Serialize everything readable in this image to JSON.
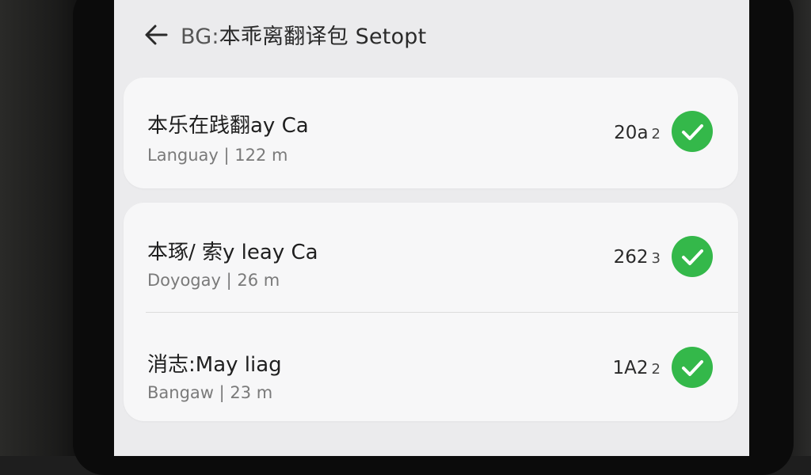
{
  "header": {
    "title_prefix": "BG:",
    "title_main": "本乖离翻译包 Setopt"
  },
  "colors": {
    "accent": "#34b84a",
    "screen_bg": "#ebebed",
    "card_bg": "#f7f7f8"
  },
  "items": [
    {
      "title": "本乐在践翻ay Ca",
      "subtitle": "Languay | 122 m",
      "count": "20a",
      "count_small": "2",
      "status_icon": "check-circle-icon"
    },
    {
      "title": "本琢/ 索y leay Ca",
      "subtitle": "Doyogay | 26 m",
      "count": "262",
      "count_small": "3",
      "status_icon": "check-circle-icon"
    },
    {
      "title": "消志:May liag",
      "subtitle": "Bangaw | 23 m",
      "count": "1A2",
      "count_small": "2",
      "status_icon": "check-circle-icon"
    }
  ]
}
